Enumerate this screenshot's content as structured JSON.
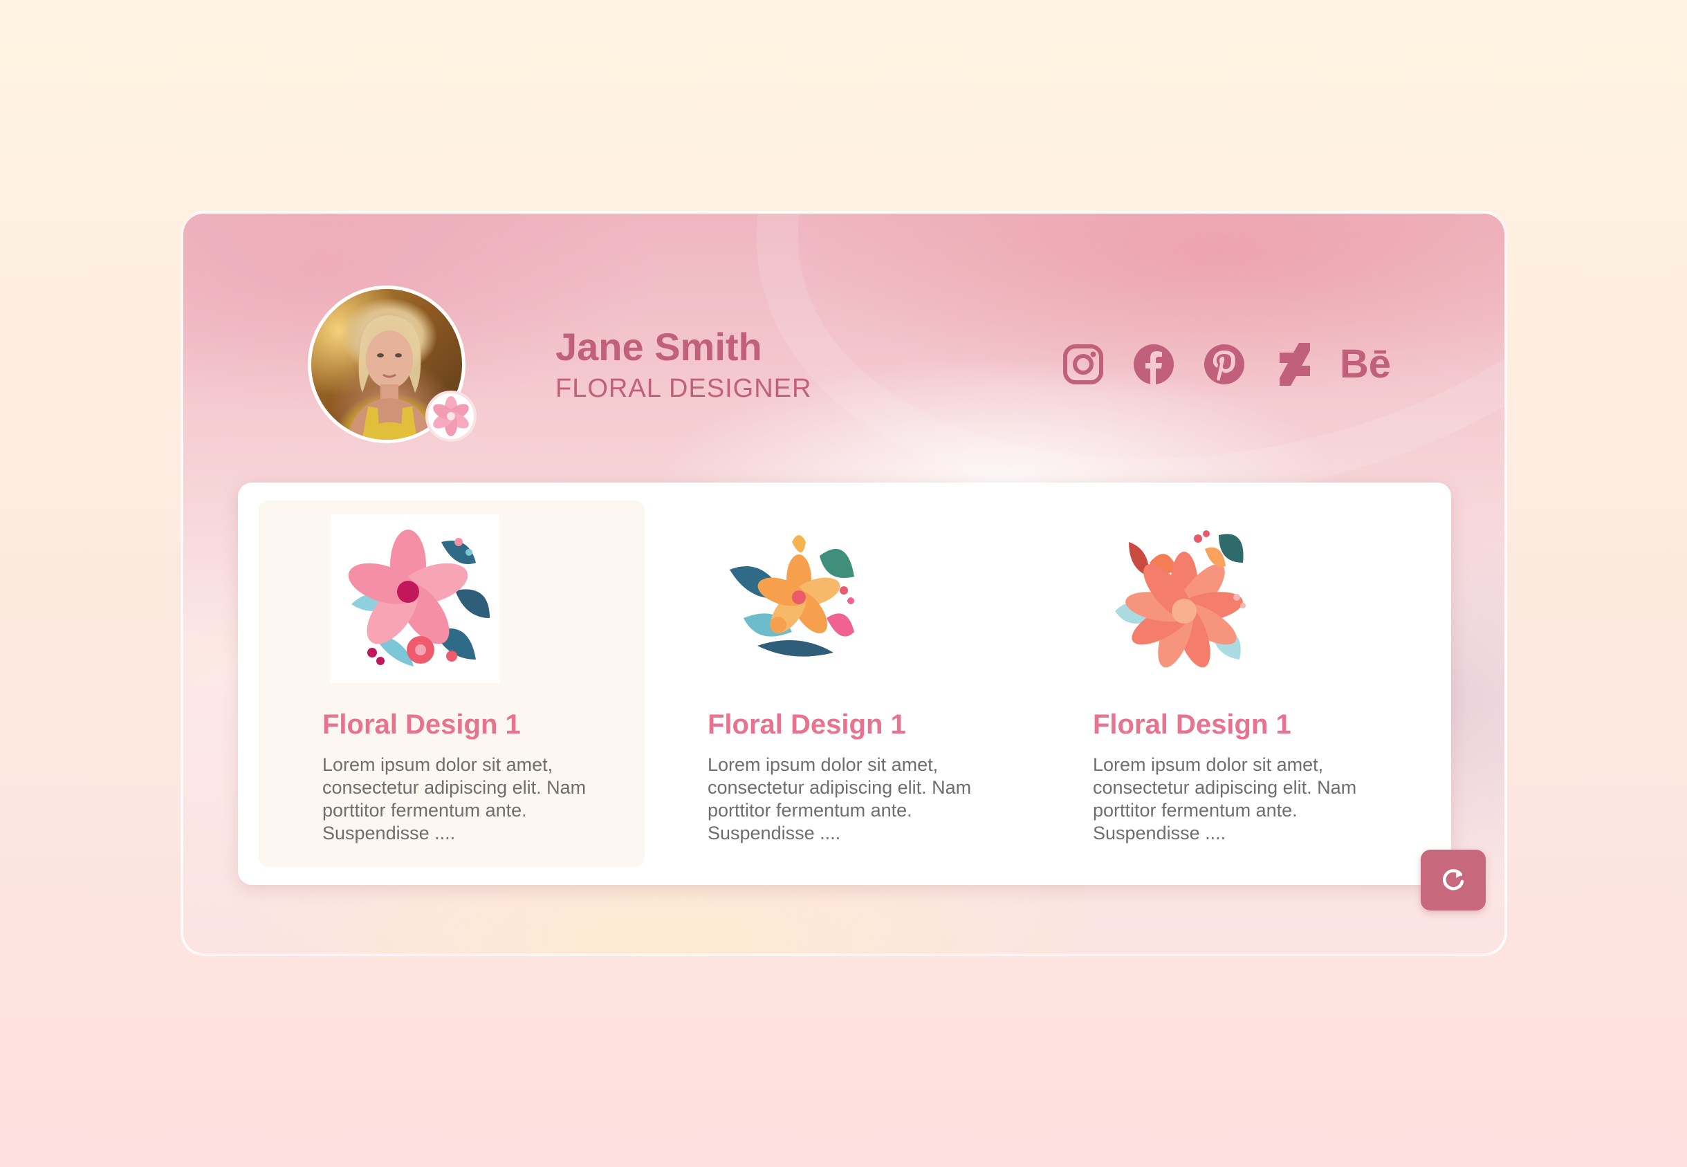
{
  "profile": {
    "name": "Jane Smith",
    "title": "FLORAL DESIGNER",
    "avatar_icon": "profile-photo",
    "badge_icon": "flower-badge-icon"
  },
  "socials": [
    {
      "icon": "instagram-icon"
    },
    {
      "icon": "facebook-icon"
    },
    {
      "icon": "pinterest-icon"
    },
    {
      "icon": "deviantart-icon"
    },
    {
      "icon": "behance-icon",
      "label": "Bē"
    }
  ],
  "gallery": {
    "items": [
      {
        "title": "Floral Design 1",
        "description": "Lorem ipsum dolor sit amet, consectetur adipiscing elit. Nam porttitor fermentum ante. Suspendisse ....",
        "selected": true
      },
      {
        "title": "Floral Design 1",
        "description": "Lorem ipsum dolor sit amet, consectetur adipiscing elit. Nam porttitor fermentum ante. Suspendisse ....",
        "selected": false
      },
      {
        "title": "Floral Design 1",
        "description": "Lorem ipsum dolor sit amet, consectetur adipiscing elit. Nam porttitor fermentum ante. Suspendisse ....",
        "selected": false
      }
    ]
  },
  "refresh_button": {
    "icon": "refresh-icon"
  },
  "colors": {
    "accent": "#c1607a",
    "item_title": "#e7738f",
    "button": "#c8687c",
    "text": "#6e6e6e"
  }
}
